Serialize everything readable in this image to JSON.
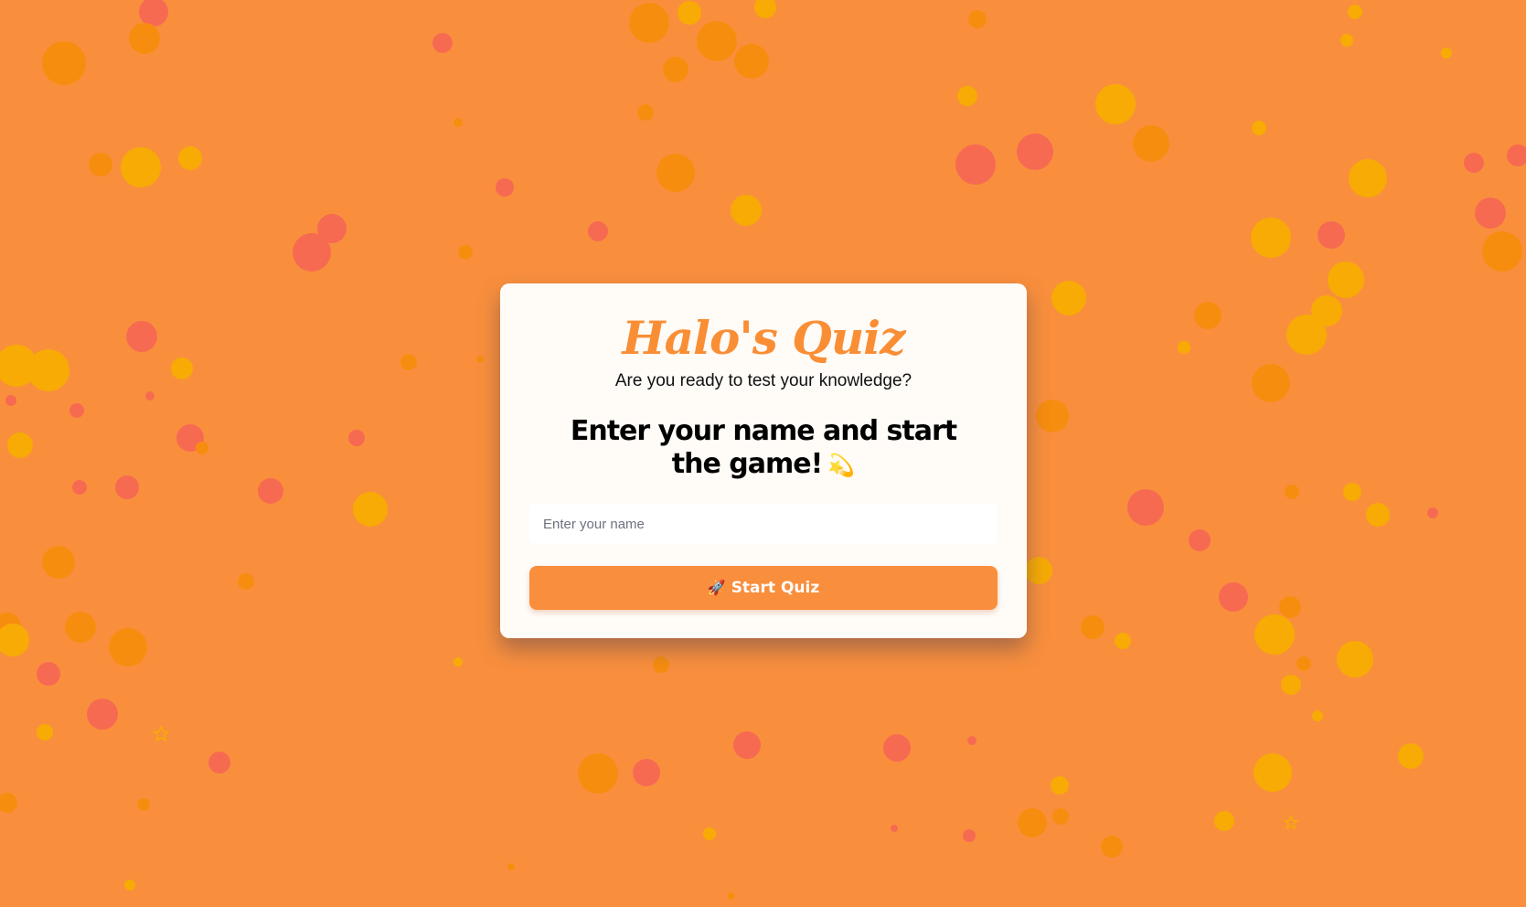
{
  "colors": {
    "background": "#f98f3d",
    "accent": "#f98e35",
    "bubble_red": "#f76a52",
    "bubble_orange": "#f78d0f",
    "bubble_yellow": "#f7ab04"
  },
  "card": {
    "title": "Halo's Quiz",
    "subtitle": "Are you ready to test your knowledge?",
    "heading": "Enter your name and start the game!",
    "heading_icon": "dizzy-star-icon",
    "name_input": {
      "value": "",
      "placeholder": "Enter your name"
    },
    "start_button": {
      "icon": "rocket-icon",
      "label": "Start Quiz"
    }
  }
}
